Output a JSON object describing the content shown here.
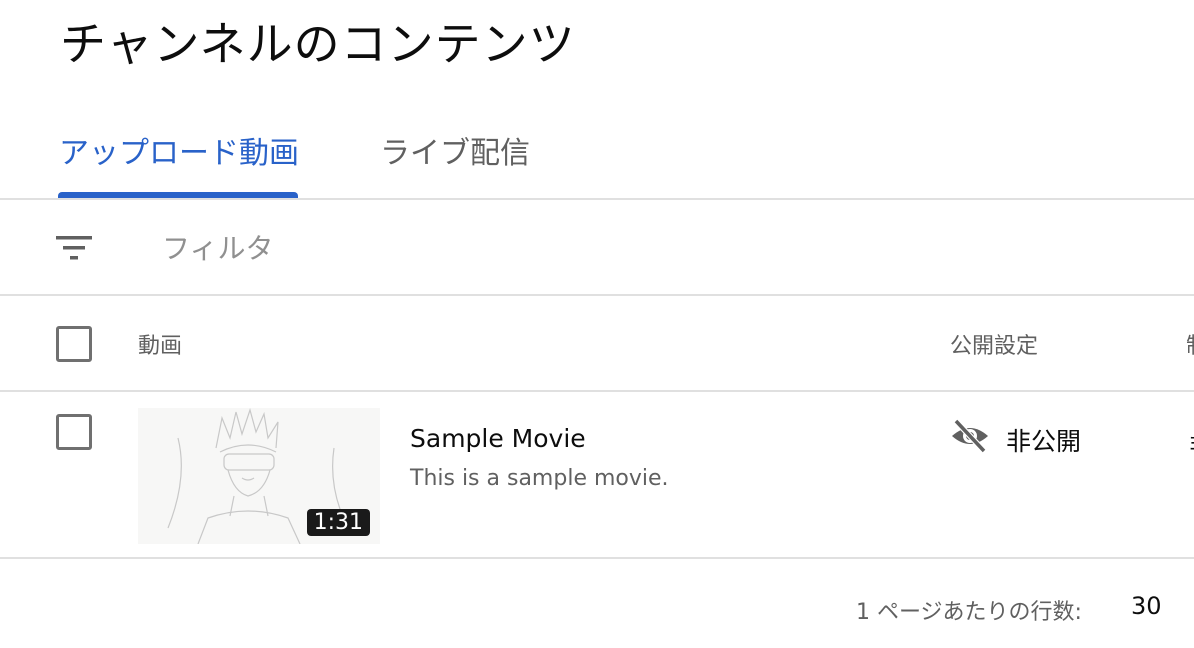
{
  "header": {
    "title": "チャンネルのコンテンツ"
  },
  "tabs": [
    {
      "label": "アップロード動画",
      "active": true
    },
    {
      "label": "ライブ配信",
      "active": false
    }
  ],
  "colors": {
    "accent": "#2962c9",
    "text": "#0d0d0d",
    "secondary_text": "#606060",
    "divider": "#e0e0e0"
  },
  "filter": {
    "icon": "filter-list-icon",
    "placeholder": "フィルタ"
  },
  "table": {
    "columns": [
      "動画",
      "公開設定"
    ],
    "truncated_column_glyph": "制",
    "rows": [
      {
        "title": "Sample Movie",
        "description": "This is a sample movie.",
        "duration": "1:31",
        "visibility": "非公開",
        "visibility_icon": "eye-off-icon",
        "truncated_cell_glyph": "⁠‌ョ"
      }
    ]
  },
  "footer": {
    "rows_per_page_label": "1 ページあたりの行数:",
    "rows_per_page_value": "30"
  }
}
